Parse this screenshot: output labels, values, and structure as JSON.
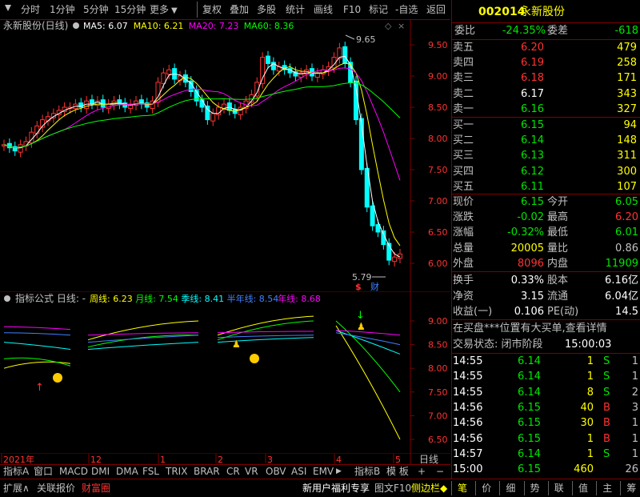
{
  "toolbar": {
    "left_items": [
      "分时",
      "1分钟",
      "5分钟",
      "15分钟",
      "更多"
    ],
    "right_items": [
      "复权",
      "叠加",
      "多股",
      "统计",
      "画线",
      "F10",
      "标记",
      "-自选",
      "返回"
    ]
  },
  "main_chart": {
    "stock_label": "永新股份(日线)",
    "ma": [
      {
        "label": "MA5: 6.07",
        "color": "#ffffff"
      },
      {
        "label": "MA10: 6.21",
        "color": "#ffff00"
      },
      {
        "label": "MA20: 7.23",
        "color": "#ff00ff"
      },
      {
        "label": "MA60: 8.36",
        "color": "#00ff00"
      }
    ],
    "y_ticks": [
      "9.50",
      "9.00",
      "8.50",
      "8.00",
      "7.50",
      "7.00",
      "6.50",
      "6.00"
    ],
    "high_label": "9.65",
    "low_label": "5.79",
    "marker_s": "$",
    "marker_cai": "财"
  },
  "indicator": {
    "title": "指标公式 日线: -",
    "lines": [
      {
        "label": "周线: 6.23",
        "color": "#ffff00"
      },
      {
        "label": "月线: 7.54",
        "color": "#00ff00"
      },
      {
        "label": "季线: 8.41",
        "color": "#00ffff"
      },
      {
        "label": "半年线: 8.54",
        "color": "#4080ff"
      },
      {
        "label": "年线: 8.68",
        "color": "#ff00ff"
      }
    ],
    "y_ticks": [
      "9.00",
      "8.50",
      "8.00",
      "7.50",
      "7.00",
      "6.50"
    ]
  },
  "time_axis": {
    "labels": [
      "2021年",
      "12",
      "1",
      "2",
      "3",
      "4",
      "5"
    ],
    "period": "日线"
  },
  "indicator_tabs": [
    "指标A",
    "窗口",
    "MACD",
    "DMI",
    "DMA",
    "FSL",
    "TRIX",
    "BRAR",
    "CR",
    "VR",
    "OBV",
    "ASI",
    "EMV",
    "指标B",
    "模 板",
    "+",
    "−"
  ],
  "bottom_bar": {
    "left": [
      "扩展∧",
      "关联报价",
      "财富圈"
    ],
    "promo": "新用户福利专享",
    "view": "图文F10",
    "side": "侧边栏◆",
    "right_tabs": [
      "笔",
      "价",
      "细",
      "势",
      "联",
      "值",
      "主",
      "筹"
    ]
  },
  "quote": {
    "code": "002014",
    "name": "永新股份",
    "weibi_label": "委比",
    "weibi_value": "-24.35%",
    "weicha_label": "委差",
    "weicha_value": "-618",
    "asks": [
      {
        "label": "卖五",
        "price": "6.20",
        "vol": "479"
      },
      {
        "label": "卖四",
        "price": "6.19",
        "vol": "258"
      },
      {
        "label": "卖三",
        "price": "6.18",
        "vol": "171"
      },
      {
        "label": "卖二",
        "price": "6.17",
        "vol": "343"
      },
      {
        "label": "卖一",
        "price": "6.16",
        "vol": "327"
      }
    ],
    "bids": [
      {
        "label": "买一",
        "price": "6.15",
        "vol": "94"
      },
      {
        "label": "买二",
        "price": "6.14",
        "vol": "148"
      },
      {
        "label": "买三",
        "price": "6.13",
        "vol": "311"
      },
      {
        "label": "买四",
        "price": "6.12",
        "vol": "300"
      },
      {
        "label": "买五",
        "price": "6.11",
        "vol": "107"
      }
    ],
    "stats": [
      {
        "l1": "现价",
        "v1": "6.15",
        "l2": "今开",
        "v2": "6.05"
      },
      {
        "l1": "涨跌",
        "v1": "-0.02",
        "l2": "最高",
        "v2": "6.20"
      },
      {
        "l1": "涨幅",
        "v1": "-0.32%",
        "l2": "最低",
        "v2": "6.01"
      },
      {
        "l1": "总量",
        "v1": "20005",
        "l2": "量比",
        "v2": "0.86"
      },
      {
        "l1": "外盘",
        "v1": "8096",
        "l2": "内盘",
        "v2": "11909"
      }
    ],
    "fund": [
      {
        "l1": "换手",
        "v1": "0.33%",
        "l2": "股本",
        "v2": "6.16亿"
      },
      {
        "l1": "净资",
        "v1": "3.15",
        "l2": "流通",
        "v2": "6.04亿"
      },
      {
        "l1": "收益(一)",
        "v1": "0.106",
        "l2": "PE(动)",
        "v2": "14.5"
      }
    ],
    "notice": "在买盘***位置有大买单,查看详情",
    "trade_status": "交易状态: 闭市阶段",
    "trade_time": "15:00:03",
    "ticks": [
      {
        "t": "14:55",
        "p": "6.14",
        "v": "1",
        "d": "S",
        "n": "1"
      },
      {
        "t": "14:55",
        "p": "6.14",
        "v": "1",
        "d": "S",
        "n": "1"
      },
      {
        "t": "14:55",
        "p": "6.14",
        "v": "8",
        "d": "S",
        "n": "2"
      },
      {
        "t": "14:56",
        "p": "6.15",
        "v": "40",
        "d": "B",
        "n": "3"
      },
      {
        "t": "14:56",
        "p": "6.15",
        "v": "30",
        "d": "B",
        "n": "1"
      },
      {
        "t": "14:56",
        "p": "6.15",
        "v": "1",
        "d": "B",
        "n": "1"
      },
      {
        "t": "14:57",
        "p": "6.14",
        "v": "1",
        "d": "S",
        "n": "1"
      },
      {
        "t": "15:00",
        "p": "6.15",
        "v": "460",
        "d": "",
        "n": "26"
      }
    ]
  }
}
